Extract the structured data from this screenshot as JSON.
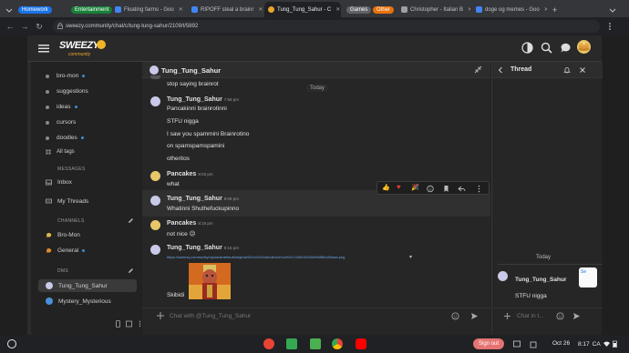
{
  "browser": {
    "tabs": [
      {
        "label": "Homework",
        "type": "group",
        "color": "#1a73e8"
      },
      {
        "label": "Entertainment",
        "type": "group",
        "color": "#188038"
      },
      {
        "label": "Floating farms - Goo",
        "type": "tab",
        "fav": "#4285f4"
      },
      {
        "label": "RIPOFF steal a brainr",
        "type": "tab",
        "fav": "#4285f4"
      },
      {
        "label": "Tung_Tung_Sahur - C",
        "type": "tab",
        "fav": "#e8a62a",
        "active": true
      },
      {
        "label": "Games",
        "type": "group",
        "color": "#5f6368"
      },
      {
        "label": "Other",
        "type": "group",
        "color": "#e8710a"
      },
      {
        "label": "Christopher - Italian B",
        "type": "tab",
        "fav": "#9aa0a6"
      },
      {
        "label": "doge og memes - Goo",
        "type": "tab",
        "fav": "#4285f4"
      }
    ],
    "url": "sweezy.community/chat/c/tung-tung-sahur/2109/t/5892"
  },
  "app": {
    "logo_text": "SWEEZY",
    "logo_sub": "community"
  },
  "sidebar": {
    "channels_top": [
      {
        "label": "bro-mon",
        "dot": true
      },
      {
        "label": "suggestions",
        "dot": false
      },
      {
        "label": "ideas",
        "dot": true
      },
      {
        "label": "cursors",
        "dot": false
      },
      {
        "label": "doodles",
        "dot": true
      }
    ],
    "all_tags": "All tags",
    "messages_head": "MESSAGES",
    "inbox": "Inbox",
    "my_threads": "My Threads",
    "channels_head": "CHANNELS",
    "channels": [
      {
        "label": "Bro-Mon",
        "color": "#d9b84a"
      },
      {
        "label": "General",
        "color": "#e08a2b"
      }
    ],
    "dms_head": "DMS",
    "dms": [
      {
        "label": "Tung_Tung_Sahur"
      },
      {
        "label": "Mystery_Mysterious"
      }
    ]
  },
  "chat": {
    "title": "Tung_Tung_Sahur",
    "today": "Today",
    "top_msg": "stop saying brainrot",
    "groups": [
      {
        "user": "Tung_Tung_Sahur",
        "time": "7:58 pm",
        "lines": [
          "Pancakinni brainrotinni",
          "STFU nigga",
          "I saw you spammini Brainrotino",
          "on spamspamspamini",
          "otheritos"
        ]
      },
      {
        "user": "Pancakes",
        "time": "8:03 pm",
        "lines": [
          "what"
        ]
      },
      {
        "user": "Tung_Tung_Sahur",
        "time": "8:09 pm",
        "lines": [
          "Whatinni Shuthefuckupinno"
        ]
      },
      {
        "user": "Pancakes",
        "time": "8:15 pm",
        "lines": [
          "not nice 😥"
        ]
      },
      {
        "user": "Tung_Tung_Sahur",
        "time": "8:16 pm",
        "lines": [
          "https://sweezy.community/uploads/default/original/3X/c/2/c20a0cab0ce1ce52c176d01523cb9fd580c80aaa.png",
          "Skibidi"
        ]
      }
    ],
    "composer_placeholder": "Chat with @Tung_Tung_Sahur"
  },
  "thread": {
    "title": "Thread",
    "today": "Today",
    "user": "Tung_Tung_Sahur",
    "reply": "STFU nigga",
    "avatar_text": "Se",
    "composer_placeholder": "Chat in t..."
  },
  "taskbar": {
    "signout": "Sign out",
    "date": "Oct 26",
    "time": "8:17",
    "region": "CA"
  }
}
